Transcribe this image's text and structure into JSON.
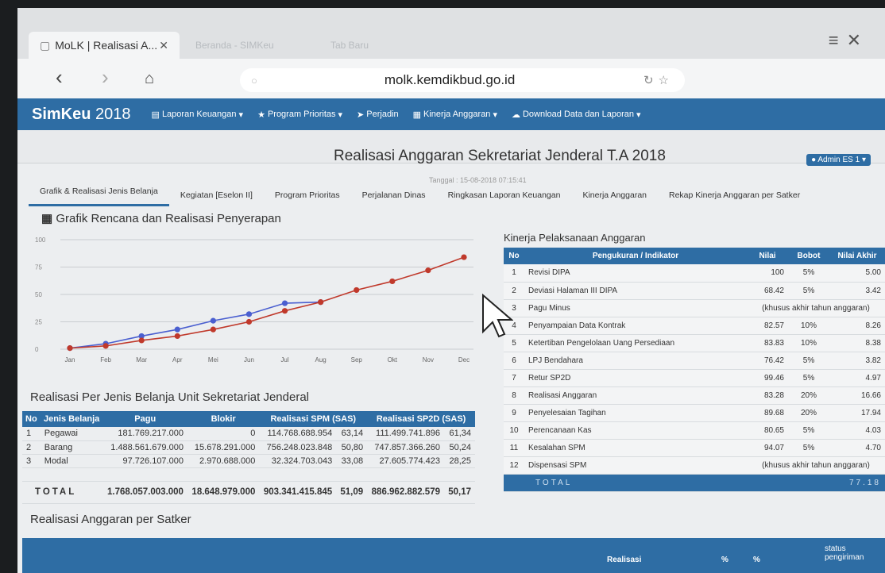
{
  "browser": {
    "active_tab": "MoLK | Realisasi A...",
    "inactive_tabs": [
      "Beranda - SIMKeu",
      "Tab Baru"
    ],
    "url": "molk.kemdikbud.go.id"
  },
  "app": {
    "brand": "SimKeu",
    "year": "2018",
    "menu": [
      {
        "label": "Laporan Keuangan",
        "icon": "document-icon"
      },
      {
        "label": "Program Prioritas",
        "icon": "star-icon"
      },
      {
        "label": "Perjadin",
        "icon": "send-icon"
      },
      {
        "label": "Kinerja Anggaran",
        "icon": "table-icon"
      },
      {
        "label": "Download Data dan Laporan",
        "icon": "cloud-download-icon"
      }
    ],
    "user": "Admin ES 1"
  },
  "page": {
    "title": "Realisasi Anggaran Sekretariat Jenderal T.A 2018",
    "date": "Tanggal : 15-08-2018 07:15:41"
  },
  "tabs": [
    "Grafik & Realisasi Jenis Belanja",
    "Kegiatan [Eselon II]",
    "Program Prioritas",
    "Perjalanan Dinas",
    "Ringkasan Laporan Keuangan",
    "Kinerja Anggaran",
    "Rekap Kinerja Anggaran per Satker"
  ],
  "chart_section_title": "Grafik Rencana dan Realisasi Penyerapan",
  "chart_data": {
    "type": "line",
    "title": "Grafik Rencana dan Realisasi Penyerapan",
    "categories": [
      "Jan",
      "Feb",
      "Mar",
      "Apr",
      "Mei",
      "Jun",
      "Jul",
      "Aug",
      "Sep",
      "Okt",
      "Nov",
      "Dec"
    ],
    "series": [
      {
        "color": "#4a5fd0",
        "values": [
          1,
          5,
          12,
          18,
          26,
          32,
          42,
          43
        ]
      },
      {
        "color": "#c0392b",
        "values": [
          1,
          3,
          8,
          12,
          18,
          25,
          35,
          43,
          54,
          62,
          72,
          84
        ]
      }
    ],
    "ylim": [
      0,
      100
    ],
    "yticks": [
      0,
      25,
      50,
      75,
      100
    ],
    "grid": true
  },
  "jenis_title": "Realisasi Per Jenis Belanja Unit Sekretariat Jenderal",
  "jenis_table": {
    "headers": [
      "No",
      "Jenis Belanja",
      "Pagu",
      "Blokir",
      "Realisasi SPM (SAS)",
      "Realisasi SP2D (SAS)"
    ],
    "rows": [
      [
        "1",
        "Pegawai",
        "181.769.217.000",
        "0",
        "114.768.688.954",
        "63,14",
        "111.499.741.896",
        "61,34"
      ],
      [
        "2",
        "Barang",
        "1.488.561.679.000",
        "15.678.291.000",
        "756.248.023.848",
        "50,80",
        "747.857.366.260",
        "50,24"
      ],
      [
        "3",
        "Modal",
        "97.726.107.000",
        "2.970.688.000",
        "32.324.703.043",
        "33,08",
        "27.605.774.423",
        "28,25"
      ]
    ],
    "total": [
      "TOTAL",
      "1.768.057.003.000",
      "18.648.979.000",
      "903.341.415.845",
      "51,09",
      "886.962.882.579",
      "50,17"
    ]
  },
  "kinerja_title": "Kinerja Pelaksanaan Anggaran",
  "kinerja_table": {
    "headers": [
      "No",
      "Pengukuran / Indikator",
      "Nilai",
      "Bobot",
      "Nilai Akhir"
    ],
    "rows": [
      [
        "1",
        "Revisi DIPA",
        "100",
        "5%",
        "5.00"
      ],
      [
        "2",
        "Deviasi Halaman III DIPA",
        "68.42",
        "5%",
        "3.42"
      ],
      [
        "3",
        "Pagu Minus",
        "(khusus akhir tahun anggaran)"
      ],
      [
        "4",
        "Penyampaian Data Kontrak",
        "82.57",
        "10%",
        "8.26"
      ],
      [
        "5",
        "Ketertiban Pengelolaan Uang Persediaan",
        "83.83",
        "10%",
        "8.38"
      ],
      [
        "6",
        "LPJ Bendahara",
        "76.42",
        "5%",
        "3.82"
      ],
      [
        "7",
        "Retur SP2D",
        "99.46",
        "5%",
        "4.97"
      ],
      [
        "8",
        "Realisasi Anggaran",
        "83.28",
        "20%",
        "16.66"
      ],
      [
        "9",
        "Penyelesaian Tagihan",
        "89.68",
        "20%",
        "17.94"
      ],
      [
        "10",
        "Perencanaan Kas",
        "80.65",
        "5%",
        "4.03"
      ],
      [
        "11",
        "Kesalahan SPM",
        "94.07",
        "5%",
        "4.70"
      ],
      [
        "12",
        "Dispensasi SPM",
        "(khusus akhir tahun anggaran)"
      ]
    ],
    "total_label": "TOTAL",
    "total_value": "77.18"
  },
  "satker_title": "Realisasi Anggaran per Satker",
  "satker_headers": [
    "Realisasi",
    "%",
    "%",
    "status pengiriman"
  ]
}
